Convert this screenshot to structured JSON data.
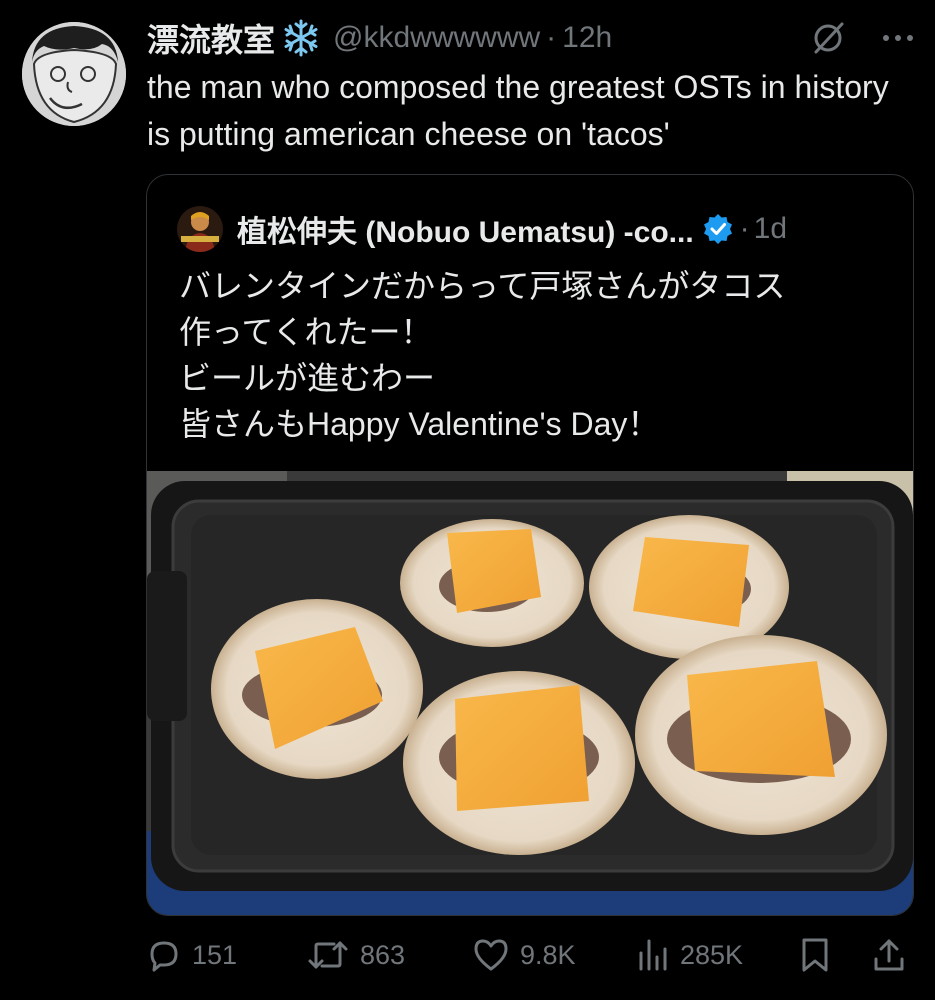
{
  "tweet": {
    "author": {
      "display_name": "漂流教室",
      "handle": "@kkdwwwwww",
      "avatar_icon": "cartoon-face-avatar",
      "badge_icon": "snowflake-icon"
    },
    "separator": "·",
    "time": "12h",
    "text": "the man who composed the greatest OSTs in history is putting american cheese on 'tacos'"
  },
  "quoted_tweet": {
    "author": {
      "display_name": "植松伸夫 (Nobuo Uematsu) -co...",
      "verified_icon": "verified-badge-icon"
    },
    "separator": "·",
    "time": "1d",
    "text_lines": [
      "バレンタインだからって戸塚さんがタコス",
      "作ってくれたー！",
      "ビールが進むわー",
      "皆さんもHappy Valentine's Day！"
    ],
    "image_icon": "tacos-on-griddle-photo"
  },
  "actions": {
    "replies": "151",
    "reposts": "863",
    "likes": "9.8K",
    "views": "285K"
  },
  "colors": {
    "background": "#000000",
    "text_primary": "#e7e9ea",
    "text_secondary": "#71767b",
    "verified": "#1d9bf0",
    "snowflake": "#7cc8f0",
    "border": "#2f3336"
  }
}
